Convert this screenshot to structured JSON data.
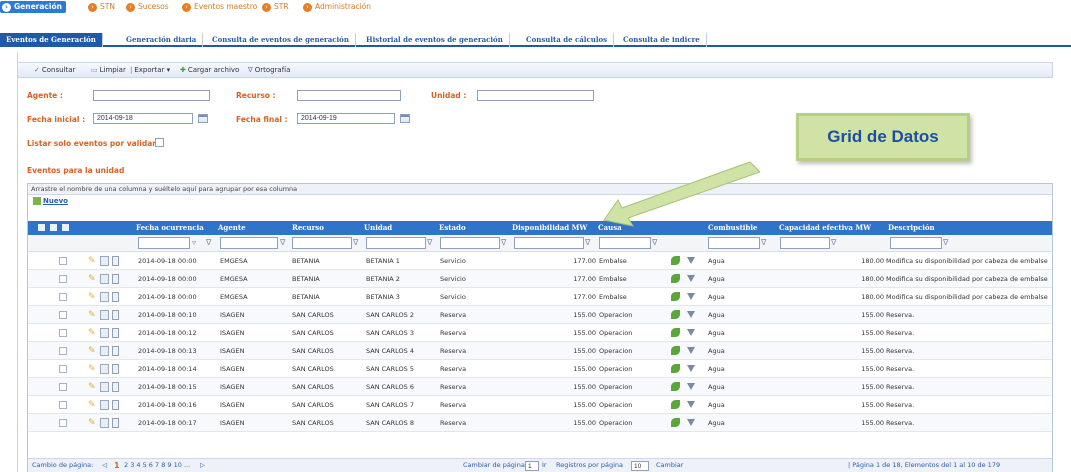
{
  "topnav": {
    "items": [
      {
        "label": "Generación",
        "active": true
      },
      {
        "label": "STN",
        "active": false
      },
      {
        "label": "Sucesos",
        "active": false
      },
      {
        "label": "Eventos maestro",
        "active": false
      },
      {
        "label": "STR",
        "active": false
      },
      {
        "label": "Administración",
        "active": false
      }
    ]
  },
  "tabs": [
    {
      "label": "Eventos de Generación",
      "active": true
    },
    {
      "label": "Generación diaria",
      "active": false
    },
    {
      "label": "Consulta de eventos de generación",
      "active": false
    },
    {
      "label": "Historial de eventos de generación",
      "active": false
    },
    {
      "label": "Consulta de cálculos",
      "active": false
    },
    {
      "label": "Consulta de indicre",
      "active": false
    }
  ],
  "toolbar": {
    "consultar": "Consultar",
    "limpiar": "Limpiar",
    "exportar": "Exportar ▾",
    "cargar": "Cargar archivo",
    "ortografia": "Ortografía"
  },
  "form": {
    "agente_label": "Agente :",
    "agente_value": "",
    "recurso_label": "Recurso :",
    "recurso_value": "",
    "unidad_label": "Unidad :",
    "unidad_value": "",
    "fecha_inicial_label": "Fecha inicial :",
    "fecha_inicial_value": "2014-09-18",
    "fecha_final_label": "Fecha final :",
    "fecha_final_value": "2014-09-19",
    "listar_label": "Listar solo eventos por validar"
  },
  "section": {
    "title": "Eventos para la unidad"
  },
  "grid": {
    "group_hint": "Arrastre el nombre de una columna y suéltelo aquí para agrupar por esa columna",
    "nuevo": "Nuevo",
    "columns": [
      "Fecha ocurrencia",
      "Agente",
      "Recurso",
      "Unidad",
      "Estado",
      "Disponibilidad MW",
      "Causa",
      "Combustible",
      "Capacidad efectiva MW",
      "Descripción"
    ],
    "rows": [
      {
        "fecha": "2014-09-18 00:00",
        "agente": "EMGESA",
        "recurso": "BETANIA",
        "unidad": "BETANIA 1",
        "estado": "Servicio",
        "disp": "177.00",
        "causa": "Embalse",
        "comb": "Agua",
        "cap": "180.00",
        "desc": "Modifica su disponibilidad por cabeza de embalse"
      },
      {
        "fecha": "2014-09-18 00:00",
        "agente": "EMGESA",
        "recurso": "BETANIA",
        "unidad": "BETANIA 2",
        "estado": "Servicio",
        "disp": "177.00",
        "causa": "Embalse",
        "comb": "Agua",
        "cap": "180.00",
        "desc": "Modifica su disponibilidad por cabeza de embalse"
      },
      {
        "fecha": "2014-09-18 00:00",
        "agente": "EMGESA",
        "recurso": "BETANIA",
        "unidad": "BETANIA 3",
        "estado": "Servicio",
        "disp": "177.00",
        "causa": "Embalse",
        "comb": "Agua",
        "cap": "180.00",
        "desc": "Modifica su disponibilidad por cabeza de embalse"
      },
      {
        "fecha": "2014-09-18 00:10",
        "agente": "ISAGEN",
        "recurso": "SAN CARLOS",
        "unidad": "SAN CARLOS 2",
        "estado": "Reserva",
        "disp": "155.00",
        "causa": "Operacion",
        "comb": "Agua",
        "cap": "155.00",
        "desc": "Reserva."
      },
      {
        "fecha": "2014-09-18 00:12",
        "agente": "ISAGEN",
        "recurso": "SAN CARLOS",
        "unidad": "SAN CARLOS 3",
        "estado": "Reserva",
        "disp": "155.00",
        "causa": "Operacion",
        "comb": "Agua",
        "cap": "155.00",
        "desc": "Reserva."
      },
      {
        "fecha": "2014-09-18 00:13",
        "agente": "ISAGEN",
        "recurso": "SAN CARLOS",
        "unidad": "SAN CARLOS 4",
        "estado": "Reserva",
        "disp": "155.00",
        "causa": "Operacion",
        "comb": "Agua",
        "cap": "155.00",
        "desc": "Reserva."
      },
      {
        "fecha": "2014-09-18 00:14",
        "agente": "ISAGEN",
        "recurso": "SAN CARLOS",
        "unidad": "SAN CARLOS 5",
        "estado": "Reserva",
        "disp": "155.00",
        "causa": "Operacion",
        "comb": "Agua",
        "cap": "155.00",
        "desc": "Reserva."
      },
      {
        "fecha": "2014-09-18 00:15",
        "agente": "ISAGEN",
        "recurso": "SAN CARLOS",
        "unidad": "SAN CARLOS 6",
        "estado": "Reserva",
        "disp": "155.00",
        "causa": "Operacion",
        "comb": "Agua",
        "cap": "155.00",
        "desc": "Reserva."
      },
      {
        "fecha": "2014-09-18 00:16",
        "agente": "ISAGEN",
        "recurso": "SAN CARLOS",
        "unidad": "SAN CARLOS 7",
        "estado": "Reserva",
        "disp": "155.00",
        "causa": "Operacion",
        "comb": "Agua",
        "cap": "155.00",
        "desc": "Reserva."
      },
      {
        "fecha": "2014-09-18 00:17",
        "agente": "ISAGEN",
        "recurso": "SAN CARLOS",
        "unidad": "SAN CARLOS 8",
        "estado": "Reserva",
        "disp": "155.00",
        "causa": "Operacion",
        "comb": "Agua",
        "cap": "155.00",
        "desc": "Reserva."
      }
    ]
  },
  "pager": {
    "cambio_label": "Cambio de página:",
    "current_page": "1",
    "pages": "2 3 4 5 6 7 8 9 10 ...",
    "cambiar_pagina_label": "Cambiar de página",
    "page_input": "1",
    "ir": "Ir",
    "registros_label": "Registros por página",
    "registros_input": "10",
    "cambiar": "Cambiar",
    "summary": "| Página 1 de 18, Elementos del 1 al 10 de 179"
  },
  "callout": {
    "text": "Grid de Datos"
  },
  "colors": {
    "accent": "#2f74c9",
    "label_orange": "#d9621c",
    "callout_bg": "#cfe3a6"
  }
}
